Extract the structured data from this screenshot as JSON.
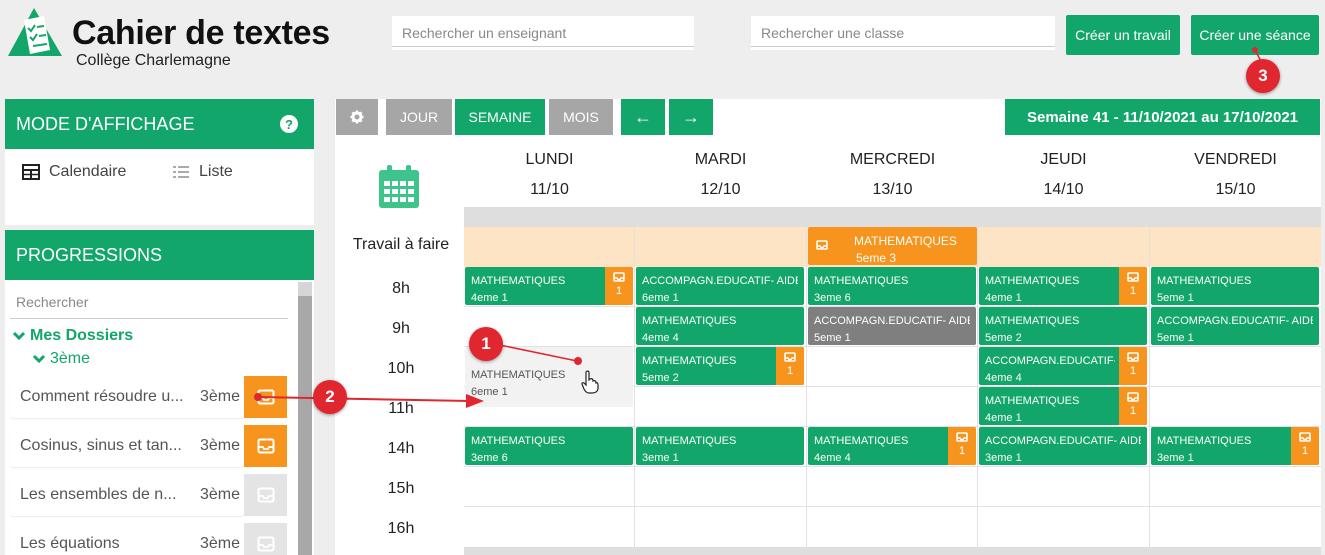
{
  "header": {
    "title": "Cahier de textes",
    "school": "Collège Charlemagne",
    "search_teacher_placeholder": "Rechercher un enseignant",
    "search_class_placeholder": "Rechercher une classe",
    "create_work_label": "Créer un travail",
    "create_session_label": "Créer une séance"
  },
  "sidebar": {
    "display_mode_title": "MODE D'AFFICHAGE",
    "help_symbol": "?",
    "calendar_label": "Calendaire",
    "list_label": "Liste",
    "progressions_title": "PROGRESSIONS",
    "search_placeholder": "Rechercher",
    "my_folders": "Mes Dossiers",
    "level": "3ème",
    "items": [
      {
        "title": "Comment résoudre u...",
        "class": "3ème",
        "color": "#f7941d"
      },
      {
        "title": "Cosinus, sinus et tan...",
        "class": "3ème",
        "color": "#f7941d"
      },
      {
        "title": "Les ensembles de n...",
        "class": "3ème",
        "color": "#e4e4e4"
      },
      {
        "title": "Les équations",
        "class": "3ème",
        "color": "#e4e4e4"
      }
    ]
  },
  "toolbar": {
    "day": "JOUR",
    "week": "SEMAINE",
    "month": "MOIS",
    "prev": "←",
    "next": "→",
    "week_range": "Semaine 41 - 11/10/2021 au 17/10/2021"
  },
  "calendar": {
    "homework_label": "Travail à faire",
    "days": [
      {
        "name": "LUNDI",
        "date": "11/10"
      },
      {
        "name": "MARDI",
        "date": "12/10"
      },
      {
        "name": "MERCREDI",
        "date": "13/10"
      },
      {
        "name": "JEUDI",
        "date": "14/10"
      },
      {
        "name": "VENDREDI",
        "date": "15/10"
      }
    ],
    "hours": [
      "8h",
      "9h",
      "10h",
      "11h",
      "14h",
      "15h",
      "16h"
    ],
    "homework_event": {
      "subject": "MATHEMATIQUES",
      "class": "5eme 3"
    },
    "events": [
      {
        "day": 0,
        "slot": 0,
        "subject": "MATHEMATIQUES",
        "class": "4eme 1",
        "color": "green",
        "badge": "1"
      },
      {
        "day": 0,
        "slot": 2,
        "subject": "MATHEMATIQUES",
        "class": "6eme 1",
        "color": "ghost",
        "badge": null
      },
      {
        "day": 0,
        "slot": 4,
        "subject": "MATHEMATIQUES",
        "class": "3eme 6",
        "color": "green",
        "badge": null
      },
      {
        "day": 1,
        "slot": 0,
        "subject": "ACCOMPAGN.EDUCATIF- AIDE ...",
        "class": "6eme 1",
        "color": "green",
        "badge": null
      },
      {
        "day": 1,
        "slot": 1,
        "subject": "MATHEMATIQUES",
        "class": "4eme 4",
        "color": "green",
        "badge": null
      },
      {
        "day": 1,
        "slot": 2,
        "subject": "MATHEMATIQUES",
        "class": "5eme 2",
        "color": "green",
        "badge": "1"
      },
      {
        "day": 1,
        "slot": 4,
        "subject": "MATHEMATIQUES",
        "class": "3eme 1",
        "color": "green",
        "badge": null
      },
      {
        "day": 2,
        "slot": 0,
        "subject": "MATHEMATIQUES",
        "class": "3eme 6",
        "color": "green",
        "badge": null
      },
      {
        "day": 2,
        "slot": 1,
        "subject": "ACCOMPAGN.EDUCATIF- AIDE ...",
        "class": "5eme 1",
        "color": "gray",
        "badge": null
      },
      {
        "day": 2,
        "slot": 4,
        "subject": "MATHEMATIQUES",
        "class": "4eme 4",
        "color": "green",
        "badge": "1"
      },
      {
        "day": 3,
        "slot": 0,
        "subject": "MATHEMATIQUES",
        "class": "4eme 1",
        "color": "green",
        "badge": "1"
      },
      {
        "day": 3,
        "slot": 1,
        "subject": "MATHEMATIQUES",
        "class": "5eme 2",
        "color": "green",
        "badge": null
      },
      {
        "day": 3,
        "slot": 2,
        "subject": "ACCOMPAGN.EDUCATIF- AIDE ...",
        "class": "4eme 4",
        "color": "green",
        "badge": "1"
      },
      {
        "day": 3,
        "slot": 3,
        "subject": "MATHEMATIQUES",
        "class": "4eme 1",
        "color": "green",
        "badge": "1"
      },
      {
        "day": 3,
        "slot": 4,
        "subject": "ACCOMPAGN.EDUCATIF- AIDE ...",
        "class": "3eme 1",
        "color": "green",
        "badge": null
      },
      {
        "day": 4,
        "slot": 0,
        "subject": "MATHEMATIQUES",
        "class": "5eme 1",
        "color": "green",
        "badge": null
      },
      {
        "day": 4,
        "slot": 1,
        "subject": "ACCOMPAGN.EDUCATIF- AIDE ...",
        "class": "5eme 1",
        "color": "green",
        "badge": null
      },
      {
        "day": 4,
        "slot": 4,
        "subject": "MATHEMATIQUES",
        "class": "3eme 1",
        "color": "green",
        "badge": "1"
      }
    ]
  },
  "annotations": {
    "m1": "1",
    "m2": "2",
    "m3": "3"
  },
  "colors": {
    "green": "#12a66a",
    "orange": "#f7941d",
    "gray": "#7f7f7f",
    "marker": "#e0262e",
    "homework_row": "#fde4c4"
  }
}
